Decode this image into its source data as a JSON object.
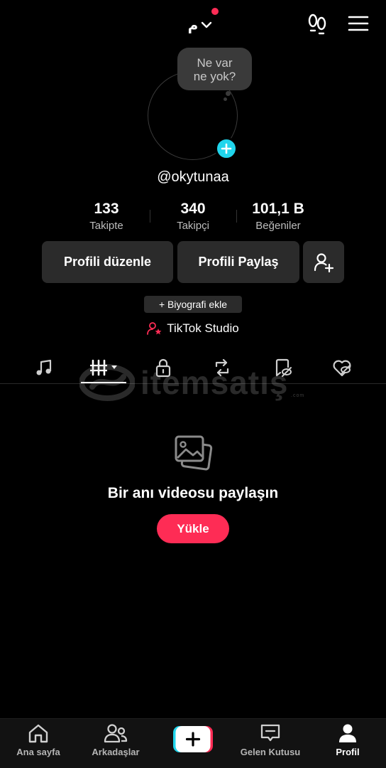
{
  "header": {
    "account_name": "م",
    "notification_dot_color": "#fe2c55"
  },
  "profile": {
    "bubble_text": "Ne var ne yok?",
    "username": "@okytunaa",
    "stats": [
      {
        "value": "133",
        "label": "Takipte"
      },
      {
        "value": "340",
        "label": "Takipçi"
      },
      {
        "value": "101,1 B",
        "label": "Beğeniler"
      }
    ],
    "edit_label": "Profili düzenle",
    "share_label": "Profili Paylaş",
    "bio_label": "+ Biyografi ekle",
    "studio_label": "TikTok Studio"
  },
  "tabs": [
    "music-icon",
    "videos-grid-icon",
    "lock-icon",
    "repost-icon",
    "saved-icon",
    "liked-icon"
  ],
  "watermark": {
    "text": "itemsatış",
    "suffix": ".com"
  },
  "empty_state": {
    "title": "Bir anı videosu paylaşın",
    "upload_label": "Yükle"
  },
  "bottom_nav": {
    "home": "Ana sayfa",
    "friends": "Arkadaşlar",
    "inbox": "Gelen Kutusu",
    "profile": "Profil"
  },
  "colors": {
    "accent": "#fe2c55",
    "cyan": "#20d5ec",
    "button_bg": "#2b2b2b"
  }
}
